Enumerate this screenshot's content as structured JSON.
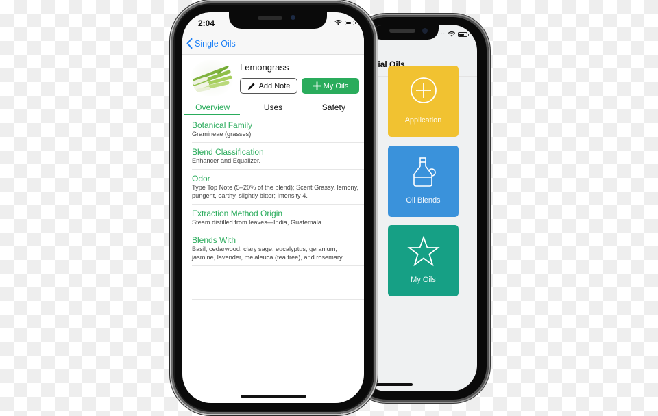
{
  "back_phone": {
    "title": "Essential Oils",
    "title_visible": "sential Oils",
    "tiles": [
      {
        "label": "",
        "color": "#e8493b"
      },
      {
        "label": "Application",
        "icon": "plus-circle-icon",
        "color": "#f1c231"
      },
      {
        "label": "",
        "color": "#27ae60"
      },
      {
        "label": "Oil Blends",
        "icon": "bottle-icon",
        "color": "#3a92db"
      },
      {
        "label": "",
        "color": "#8e44ad"
      },
      {
        "label": "My Oils",
        "icon": "star-icon",
        "color": "#16a085"
      }
    ]
  },
  "front_phone": {
    "status": {
      "time": "2:04"
    },
    "nav": {
      "back_label": "Single Oils"
    },
    "oil": {
      "name": "Lemongrass",
      "add_note_label": "Add Note",
      "my_oils_label": "My Oils"
    },
    "tabs": [
      {
        "label": "Overview",
        "active": true
      },
      {
        "label": "Uses",
        "active": false
      },
      {
        "label": "Safety",
        "active": false
      }
    ],
    "overview": [
      {
        "title": "Botanical Family",
        "body": "Gramineae (grasses)"
      },
      {
        "title": "Blend Classification",
        "body": "Enhancer and Equalizer."
      },
      {
        "title": "Odor",
        "body": "Type Top Note (5–20% of the blend); Scent Grassy, lemony, pungent, earthy, slightly bitter; Intensity 4."
      },
      {
        "title": "Extraction Method Origin",
        "body": "Steam distilled from leaves—India, Guatemala"
      },
      {
        "title": "Blends With",
        "body": "Basil, cedarwood, clary sage, eucalyptus, geranium, jasmine, lavender, melaleuca (tea tree), and rosemary."
      }
    ]
  },
  "colors": {
    "accent_green": "#2aac5c",
    "link_blue": "#1a7ef5"
  }
}
